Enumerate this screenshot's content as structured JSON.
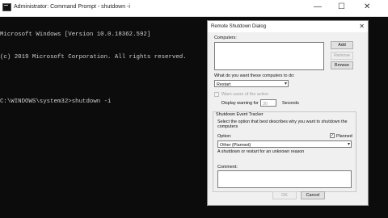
{
  "cmd": {
    "title": "Administrator: Command Prompt - shutdown  -i",
    "controls": {
      "minimize": "—",
      "maximize": "☐",
      "close": "✕"
    },
    "lines": [
      "Microsoft Windows [Version 10.0.18362.592]",
      "(c) 2019 Microsoft Corporation. All rights reserved.",
      "",
      "C:\\WINDOWS\\system32>shutdown -i"
    ]
  },
  "dialog": {
    "title": "Remote Shutdown Dialog",
    "close": "✕",
    "computers_label": "Computers:",
    "add_label": "Add",
    "remove_label": "Remove",
    "browse_label": "Browse",
    "action_question": "What do you want these computers to do:",
    "action_value": "Restart",
    "warn_label": "Warn users of the action",
    "display_warning_label": "Display warning for",
    "warning_value": "30",
    "seconds_label": "Seconds",
    "tracker_title": "Shutdown Event Tracker",
    "tracker_desc": "Select the option that best describes why you want to shutdown the computers",
    "option_label": "Option:",
    "planned_label": "Planned",
    "planned_check": "✓",
    "option_value": "Other (Planned)",
    "reason_desc": "A shutdown or restart for an unknown reason",
    "comment_label": "Comment:",
    "ok_label": "OK",
    "cancel_label": "Cancel"
  }
}
